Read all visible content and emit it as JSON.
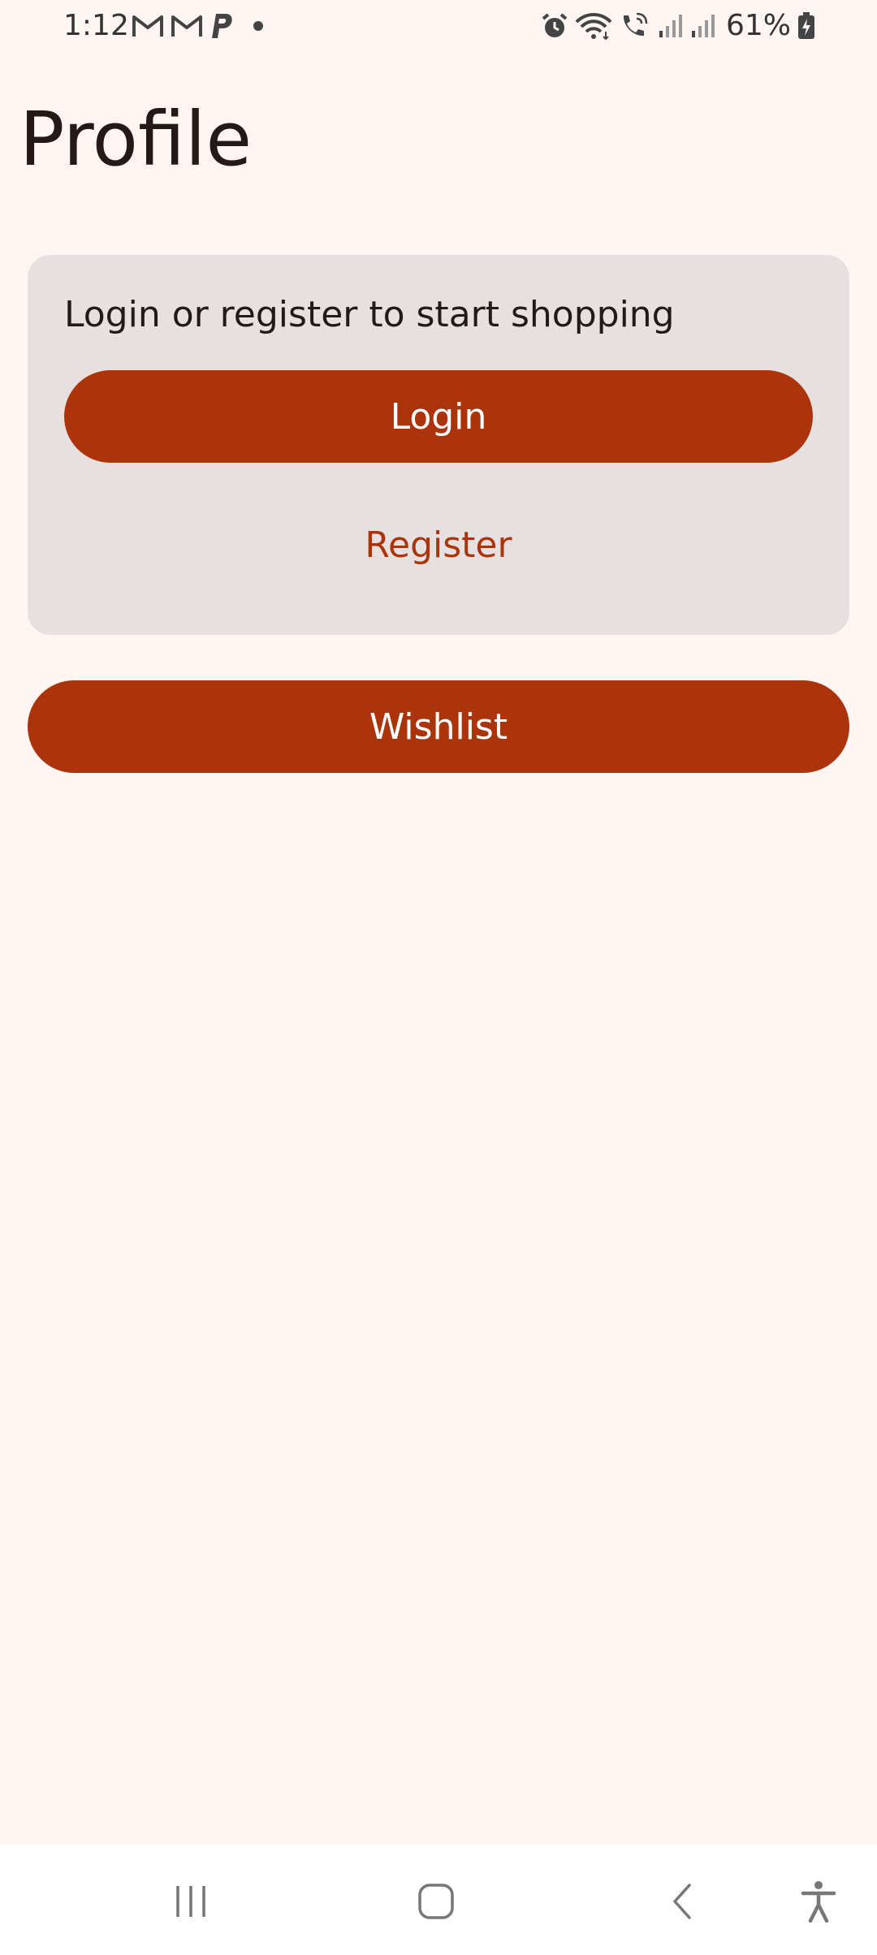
{
  "status_bar": {
    "time": "1:12",
    "battery": "61%",
    "left_icons": [
      "gmail-icon",
      "gmail-icon",
      "paypal-icon",
      "notification-dot-icon"
    ],
    "right_icons": [
      "alarm-icon",
      "wifi-icon",
      "wifi-calling-icon",
      "signal-icon",
      "signal-icon",
      "battery-charging-icon"
    ]
  },
  "page": {
    "title": "Profile"
  },
  "auth_card": {
    "prompt": "Login or register to start shopping",
    "login_label": "Login",
    "register_label": "Register"
  },
  "wishlist_label": "Wishlist",
  "nav_bar": {
    "buttons": [
      "recent-apps-icon",
      "home-icon",
      "back-icon",
      "accessibility-icon"
    ]
  },
  "colors": {
    "background": "#FFF6F4",
    "card": "#E6E1E0",
    "accent": "#AC340B",
    "on_accent": "#FFFFFF",
    "text": "#231917"
  }
}
